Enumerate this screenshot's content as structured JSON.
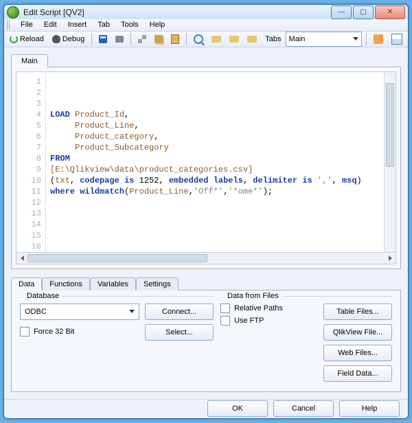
{
  "window": {
    "title": "Edit Script [QV2]"
  },
  "menu": {
    "file": "File",
    "edit": "Edit",
    "insert": "Insert",
    "tab": "Tab",
    "tools": "Tools",
    "help": "Help"
  },
  "toolbar": {
    "reload": "Reload",
    "debug": "Debug",
    "tabs_label": "Tabs",
    "tab_selected": "Main"
  },
  "editor": {
    "tab_label": "Main",
    "gutter": "1\n2\n3\n4\n5\n6\n7\n8\n9\n10\n11\n12\n13\n14\n15\n16",
    "lines": [
      [],
      [],
      [],
      [
        {
          "t": "LOAD ",
          "c": "kw"
        },
        {
          "t": "Product_Id",
          "c": "id"
        },
        {
          "t": ",",
          "c": "plain"
        }
      ],
      [
        {
          "t": "     ",
          "c": "plain"
        },
        {
          "t": "Product_Line",
          "c": "id"
        },
        {
          "t": ",",
          "c": "plain"
        }
      ],
      [
        {
          "t": "     ",
          "c": "plain"
        },
        {
          "t": "Product_category",
          "c": "id"
        },
        {
          "t": ",",
          "c": "plain"
        }
      ],
      [
        {
          "t": "     ",
          "c": "plain"
        },
        {
          "t": "Product_Subcategory",
          "c": "id"
        }
      ],
      [
        {
          "t": "FROM",
          "c": "kw"
        }
      ],
      [
        {
          "t": "[E:\\Qlikview\\data\\product_categories.csv]",
          "c": "id"
        }
      ],
      [
        {
          "t": "(",
          "c": "plain"
        },
        {
          "t": "txt",
          "c": "id"
        },
        {
          "t": ", ",
          "c": "plain"
        },
        {
          "t": "codepage is",
          "c": "kw"
        },
        {
          "t": " 1252, ",
          "c": "plain"
        },
        {
          "t": "embedded labels",
          "c": "kw"
        },
        {
          "t": ", ",
          "c": "plain"
        },
        {
          "t": "delimiter is",
          "c": "kw"
        },
        {
          "t": " ",
          "c": "plain"
        },
        {
          "t": "','",
          "c": "str"
        },
        {
          "t": ", ",
          "c": "plain"
        },
        {
          "t": "msq",
          "c": "kw"
        },
        {
          "t": ")",
          "c": "plain"
        }
      ],
      [
        {
          "t": "where wildmatch",
          "c": "kw"
        },
        {
          "t": "(",
          "c": "plain"
        },
        {
          "t": "Product_Line",
          "c": "id"
        },
        {
          "t": ",",
          "c": "plain"
        },
        {
          "t": "'Off*'",
          "c": "str"
        },
        {
          "t": ",",
          "c": "plain"
        },
        {
          "t": "'*ome*'",
          "c": "str"
        },
        {
          "t": ")",
          "c": "plain"
        },
        {
          "t": ";",
          "c": "plain"
        }
      ],
      [],
      [],
      [],
      [],
      []
    ]
  },
  "bottom": {
    "tabs": {
      "data": "Data",
      "functions": "Functions",
      "variables": "Variables",
      "settings": "Settings"
    },
    "database": {
      "title": "Database",
      "selected": "ODBC",
      "connect": "Connect...",
      "select": "Select...",
      "force32": "Force 32 Bit"
    },
    "files": {
      "title": "Data from Files",
      "relative": "Relative Paths",
      "ftp": "Use FTP",
      "table": "Table Files...",
      "qlik": "QlikView File...",
      "web": "Web Files...",
      "field": "Field Data..."
    }
  },
  "footer": {
    "ok": "OK",
    "cancel": "Cancel",
    "help": "Help"
  }
}
